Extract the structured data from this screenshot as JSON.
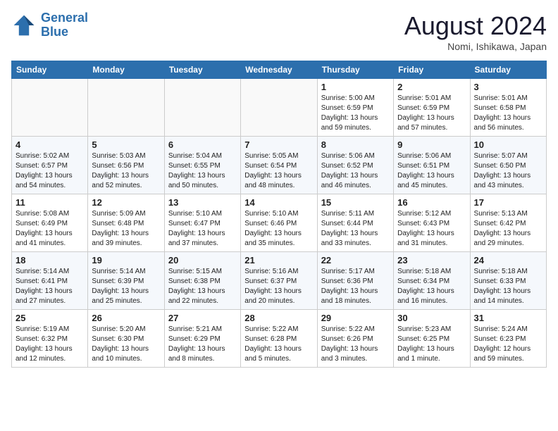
{
  "header": {
    "logo_line1": "General",
    "logo_line2": "Blue",
    "month": "August 2024",
    "location": "Nomi, Ishikawa, Japan"
  },
  "weekdays": [
    "Sunday",
    "Monday",
    "Tuesday",
    "Wednesday",
    "Thursday",
    "Friday",
    "Saturday"
  ],
  "weeks": [
    [
      {
        "day": "",
        "info": ""
      },
      {
        "day": "",
        "info": ""
      },
      {
        "day": "",
        "info": ""
      },
      {
        "day": "",
        "info": ""
      },
      {
        "day": "1",
        "info": "Sunrise: 5:00 AM\nSunset: 6:59 PM\nDaylight: 13 hours\nand 59 minutes."
      },
      {
        "day": "2",
        "info": "Sunrise: 5:01 AM\nSunset: 6:59 PM\nDaylight: 13 hours\nand 57 minutes."
      },
      {
        "day": "3",
        "info": "Sunrise: 5:01 AM\nSunset: 6:58 PM\nDaylight: 13 hours\nand 56 minutes."
      }
    ],
    [
      {
        "day": "4",
        "info": "Sunrise: 5:02 AM\nSunset: 6:57 PM\nDaylight: 13 hours\nand 54 minutes."
      },
      {
        "day": "5",
        "info": "Sunrise: 5:03 AM\nSunset: 6:56 PM\nDaylight: 13 hours\nand 52 minutes."
      },
      {
        "day": "6",
        "info": "Sunrise: 5:04 AM\nSunset: 6:55 PM\nDaylight: 13 hours\nand 50 minutes."
      },
      {
        "day": "7",
        "info": "Sunrise: 5:05 AM\nSunset: 6:54 PM\nDaylight: 13 hours\nand 48 minutes."
      },
      {
        "day": "8",
        "info": "Sunrise: 5:06 AM\nSunset: 6:52 PM\nDaylight: 13 hours\nand 46 minutes."
      },
      {
        "day": "9",
        "info": "Sunrise: 5:06 AM\nSunset: 6:51 PM\nDaylight: 13 hours\nand 45 minutes."
      },
      {
        "day": "10",
        "info": "Sunrise: 5:07 AM\nSunset: 6:50 PM\nDaylight: 13 hours\nand 43 minutes."
      }
    ],
    [
      {
        "day": "11",
        "info": "Sunrise: 5:08 AM\nSunset: 6:49 PM\nDaylight: 13 hours\nand 41 minutes."
      },
      {
        "day": "12",
        "info": "Sunrise: 5:09 AM\nSunset: 6:48 PM\nDaylight: 13 hours\nand 39 minutes."
      },
      {
        "day": "13",
        "info": "Sunrise: 5:10 AM\nSunset: 6:47 PM\nDaylight: 13 hours\nand 37 minutes."
      },
      {
        "day": "14",
        "info": "Sunrise: 5:10 AM\nSunset: 6:46 PM\nDaylight: 13 hours\nand 35 minutes."
      },
      {
        "day": "15",
        "info": "Sunrise: 5:11 AM\nSunset: 6:44 PM\nDaylight: 13 hours\nand 33 minutes."
      },
      {
        "day": "16",
        "info": "Sunrise: 5:12 AM\nSunset: 6:43 PM\nDaylight: 13 hours\nand 31 minutes."
      },
      {
        "day": "17",
        "info": "Sunrise: 5:13 AM\nSunset: 6:42 PM\nDaylight: 13 hours\nand 29 minutes."
      }
    ],
    [
      {
        "day": "18",
        "info": "Sunrise: 5:14 AM\nSunset: 6:41 PM\nDaylight: 13 hours\nand 27 minutes."
      },
      {
        "day": "19",
        "info": "Sunrise: 5:14 AM\nSunset: 6:39 PM\nDaylight: 13 hours\nand 25 minutes."
      },
      {
        "day": "20",
        "info": "Sunrise: 5:15 AM\nSunset: 6:38 PM\nDaylight: 13 hours\nand 22 minutes."
      },
      {
        "day": "21",
        "info": "Sunrise: 5:16 AM\nSunset: 6:37 PM\nDaylight: 13 hours\nand 20 minutes."
      },
      {
        "day": "22",
        "info": "Sunrise: 5:17 AM\nSunset: 6:36 PM\nDaylight: 13 hours\nand 18 minutes."
      },
      {
        "day": "23",
        "info": "Sunrise: 5:18 AM\nSunset: 6:34 PM\nDaylight: 13 hours\nand 16 minutes."
      },
      {
        "day": "24",
        "info": "Sunrise: 5:18 AM\nSunset: 6:33 PM\nDaylight: 13 hours\nand 14 minutes."
      }
    ],
    [
      {
        "day": "25",
        "info": "Sunrise: 5:19 AM\nSunset: 6:32 PM\nDaylight: 13 hours\nand 12 minutes."
      },
      {
        "day": "26",
        "info": "Sunrise: 5:20 AM\nSunset: 6:30 PM\nDaylight: 13 hours\nand 10 minutes."
      },
      {
        "day": "27",
        "info": "Sunrise: 5:21 AM\nSunset: 6:29 PM\nDaylight: 13 hours\nand 8 minutes."
      },
      {
        "day": "28",
        "info": "Sunrise: 5:22 AM\nSunset: 6:28 PM\nDaylight: 13 hours\nand 5 minutes."
      },
      {
        "day": "29",
        "info": "Sunrise: 5:22 AM\nSunset: 6:26 PM\nDaylight: 13 hours\nand 3 minutes."
      },
      {
        "day": "30",
        "info": "Sunrise: 5:23 AM\nSunset: 6:25 PM\nDaylight: 13 hours\nand 1 minute."
      },
      {
        "day": "31",
        "info": "Sunrise: 5:24 AM\nSunset: 6:23 PM\nDaylight: 12 hours\nand 59 minutes."
      }
    ]
  ]
}
